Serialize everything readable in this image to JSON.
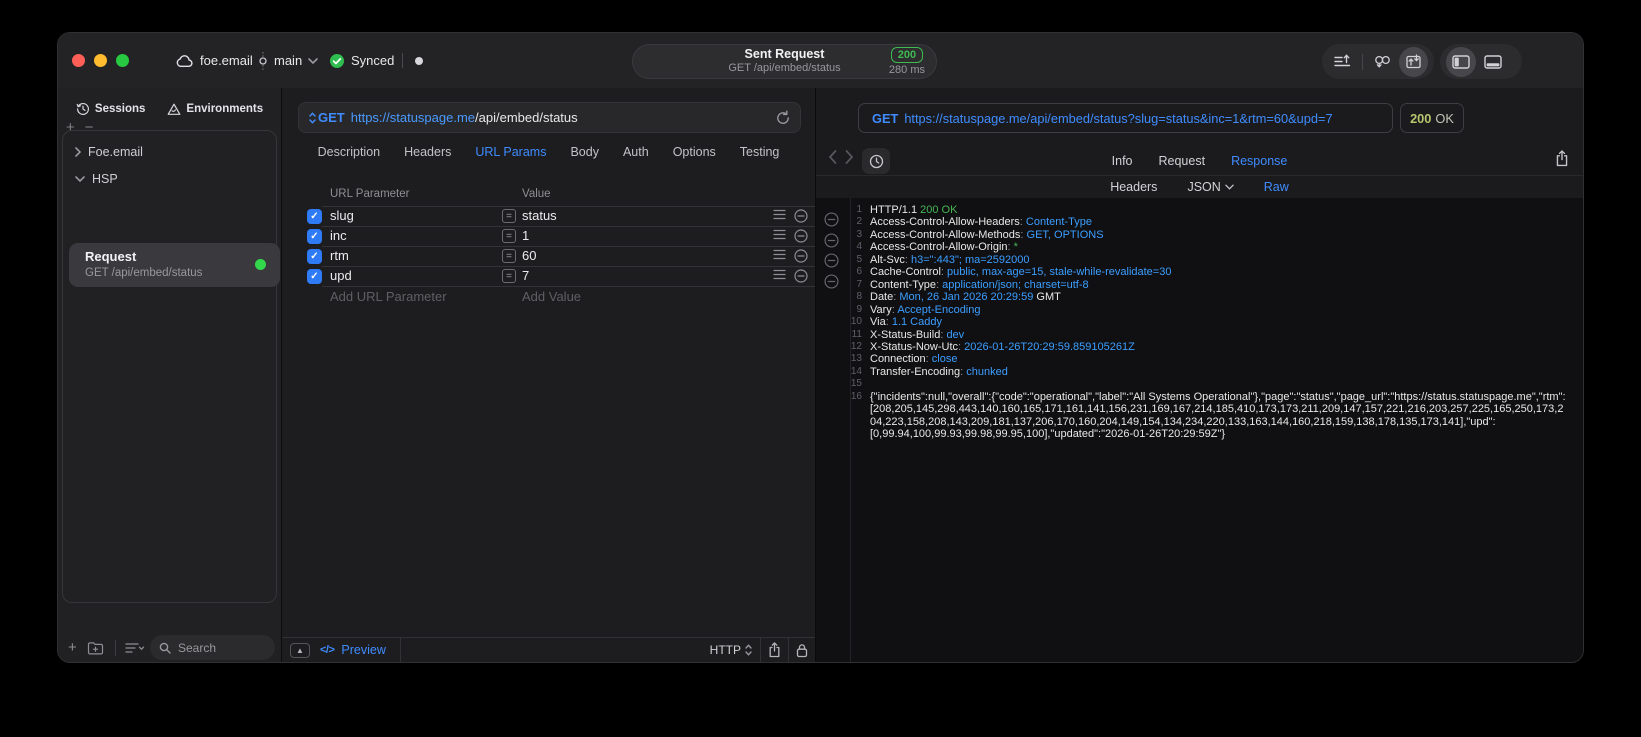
{
  "titlebar": {
    "project": "foe.email",
    "branch": "main",
    "sync_status": "Synced",
    "request": {
      "title": "Sent Request",
      "subtitle": "GET /api/embed/status",
      "status_code": "200",
      "duration": "280 ms"
    }
  },
  "sidebar": {
    "tabs": [
      {
        "label": "Sessions"
      },
      {
        "label": "Environments"
      }
    ],
    "tree": [
      {
        "label": "Foe.email"
      },
      {
        "label": "HSP"
      }
    ],
    "request_item": {
      "title": "Request",
      "subtitle": "GET /api/embed/status"
    },
    "search_placeholder": "Search"
  },
  "request_pane": {
    "method": "GET",
    "url_host": "https://statuspage.me",
    "url_path": "/api/embed/status",
    "tabs": [
      {
        "label": "Description"
      },
      {
        "label": "Headers"
      },
      {
        "label": "URL Params"
      },
      {
        "label": "Body"
      },
      {
        "label": "Auth"
      },
      {
        "label": "Options"
      },
      {
        "label": "Testing"
      }
    ],
    "active_tab": "URL Params",
    "params": {
      "col_param": "URL Parameter",
      "col_value": "Value",
      "rows": [
        {
          "name": "slug",
          "value": "status",
          "enabled": true
        },
        {
          "name": "inc",
          "value": "1",
          "enabled": true
        },
        {
          "name": "rtm",
          "value": "60",
          "enabled": true
        },
        {
          "name": "upd",
          "value": "7",
          "enabled": true
        }
      ],
      "add_param": "Add URL Parameter",
      "add_value": "Add Value"
    },
    "footer": {
      "code_glyph": "</>",
      "preview": "Preview",
      "protocol": "HTTP"
    }
  },
  "response_pane": {
    "method": "GET",
    "url": "https://statuspage.me/api/embed/status?slug=status&inc=1&rtm=60&upd=7",
    "status_code": "200",
    "status_text": "OK",
    "tabs": [
      {
        "label": "Info"
      },
      {
        "label": "Request"
      },
      {
        "label": "Response"
      }
    ],
    "active_tab": "Response",
    "view_tabs": [
      {
        "label": "Headers"
      },
      {
        "label": "JSON"
      },
      {
        "label": "Raw"
      }
    ],
    "active_view": "Raw",
    "code_lines": [
      {
        "n": "1",
        "segs": [
          {
            "t": "HTTP/1.1 ",
            "c": "plain"
          },
          {
            "t": "200 OK",
            "c": "green"
          }
        ]
      },
      {
        "n": "2",
        "segs": [
          {
            "t": "Access-Control-Allow-Headers",
            "c": "key"
          },
          {
            "t": ": ",
            "c": "punct"
          },
          {
            "t": "Content-Type",
            "c": "val"
          }
        ]
      },
      {
        "n": "3",
        "segs": [
          {
            "t": "Access-Control-Allow-Methods",
            "c": "key"
          },
          {
            "t": ": ",
            "c": "punct"
          },
          {
            "t": "GET, OPTIONS",
            "c": "val"
          }
        ]
      },
      {
        "n": "4",
        "segs": [
          {
            "t": "Access-Control-Allow-Origin",
            "c": "key"
          },
          {
            "t": ": ",
            "c": "punct"
          },
          {
            "t": "*",
            "c": "green"
          }
        ]
      },
      {
        "n": "5",
        "segs": [
          {
            "t": "Alt-Svc",
            "c": "key"
          },
          {
            "t": ": ",
            "c": "punct"
          },
          {
            "t": "h3=\":443\"; ma=2592000",
            "c": "val"
          }
        ]
      },
      {
        "n": "6",
        "segs": [
          {
            "t": "Cache-Control",
            "c": "key"
          },
          {
            "t": ": ",
            "c": "punct"
          },
          {
            "t": "public, max-age=15, stale-while-revalidate=30",
            "c": "val"
          }
        ]
      },
      {
        "n": "7",
        "segs": [
          {
            "t": "Content-Type",
            "c": "key"
          },
          {
            "t": ": ",
            "c": "punct"
          },
          {
            "t": "application/json; charset=utf-8",
            "c": "val"
          }
        ]
      },
      {
        "n": "8",
        "segs": [
          {
            "t": "Date",
            "c": "key"
          },
          {
            "t": ": ",
            "c": "punct"
          },
          {
            "t": "Mon, 26 Jan 2026 20:29:59",
            "c": "val"
          },
          {
            "t": " GMT",
            "c": "plain"
          }
        ]
      },
      {
        "n": "9",
        "segs": [
          {
            "t": "Vary",
            "c": "key"
          },
          {
            "t": ": ",
            "c": "punct"
          },
          {
            "t": "Accept-Encoding",
            "c": "val"
          }
        ]
      },
      {
        "n": "10",
        "segs": [
          {
            "t": "Via",
            "c": "key"
          },
          {
            "t": ": ",
            "c": "punct"
          },
          {
            "t": "1.1 Caddy",
            "c": "val"
          }
        ]
      },
      {
        "n": "11",
        "segs": [
          {
            "t": "X-Status-Build",
            "c": "key"
          },
          {
            "t": ": ",
            "c": "punct"
          },
          {
            "t": "dev",
            "c": "val"
          }
        ]
      },
      {
        "n": "12",
        "segs": [
          {
            "t": "X-Status-Now-Utc",
            "c": "key"
          },
          {
            "t": ": ",
            "c": "punct"
          },
          {
            "t": "2026-01-26T20:29:59.859105261Z",
            "c": "val"
          }
        ]
      },
      {
        "n": "13",
        "segs": [
          {
            "t": "Connection",
            "c": "key"
          },
          {
            "t": ": ",
            "c": "punct"
          },
          {
            "t": "close",
            "c": "val"
          }
        ]
      },
      {
        "n": "14",
        "segs": [
          {
            "t": "Transfer-Encoding",
            "c": "key"
          },
          {
            "t": ": ",
            "c": "punct"
          },
          {
            "t": "chunked",
            "c": "val"
          }
        ]
      },
      {
        "n": "15",
        "segs": []
      },
      {
        "n": "16",
        "segs": [
          {
            "t": "{\"incidents\":null,\"overall\":{\"code\":\"operational\",\"label\":\"All Systems Operational\"},\"page\":\"status\",\"page_url\":\"https://status.statuspage.me\",\"rtm\":[208,205,145,298,443,140,160,165,171,161,141,156,231,169,167,214,185,410,173,173,211,209,147,157,221,216,203,257,225,165,250,173,204,223,158,208,143,209,181,137,206,170,160,204,149,154,134,234,220,133,163,144,160,218,159,138,178,135,173,141],\"upd\":[0,99.94,100,99.93,99.98,99.95,100],\"updated\":\"2026-01-26T20:29:59Z\"}",
            "c": "plain"
          }
        ]
      }
    ]
  },
  "colors": {
    "accent_blue": "#3f8cff",
    "success_green": "#32d74b",
    "badge_green": "#3fb950",
    "status_olive": "#b8c56f",
    "checkbox_blue": "#2f7bf5"
  }
}
